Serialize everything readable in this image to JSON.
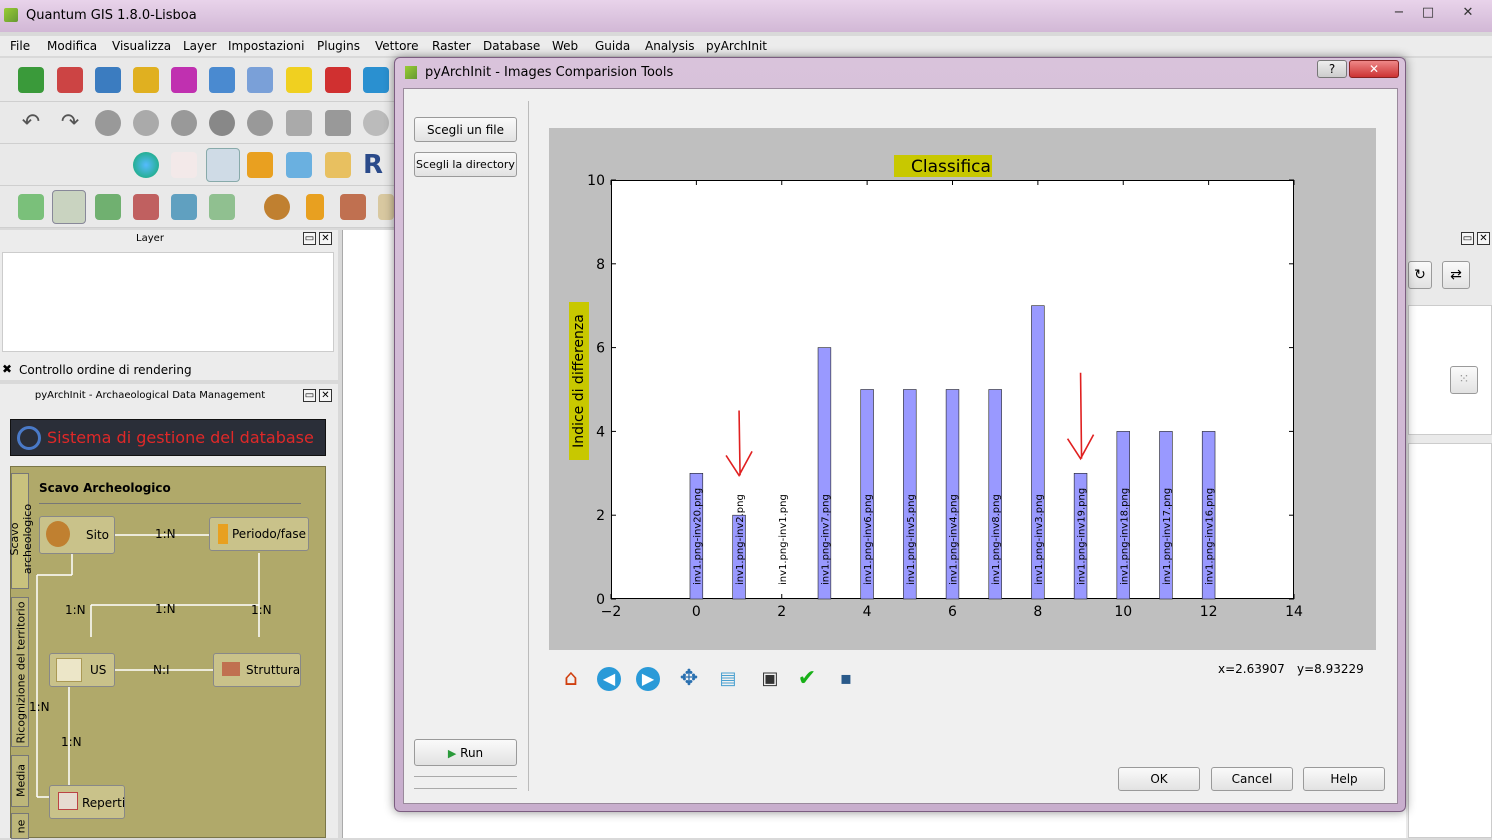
{
  "app": {
    "title": "Quantum GIS 1.8.0-Lisboa",
    "window_buttons": [
      "−",
      "□",
      "✕"
    ]
  },
  "menu": [
    "File",
    "Modifica",
    "Visualizza",
    "Layer",
    "Impostazioni",
    "Plugins",
    "Vettore",
    "Raster",
    "Database",
    "Web",
    "Guida",
    "Analysis",
    "pyArchInit"
  ],
  "layer_panel": {
    "title": "Layer",
    "render_order_label": "Controllo ordine di rendering"
  },
  "pyarchinit_panel": {
    "title": "pyArchInit - Archaeological Data Management",
    "banner": "Sistema di gestione del database",
    "tabs": [
      "Scavo archeologico",
      "Ricognizione del territorio",
      "Media",
      "ne"
    ],
    "section_title": "Scavo Archeologico",
    "nodes": {
      "sito": "Sito",
      "periodo": "Periodo/fase",
      "us": "US",
      "struttura": "Struttura",
      "reperti": "Reperti"
    },
    "relations": {
      "sito_periodo": "1:N",
      "sito_down": "1:N",
      "mid_center": "1:N",
      "mid_right": "1:N",
      "us_struttura": "N:I",
      "side": "1:N",
      "us_reperti": "1:N"
    }
  },
  "dialog": {
    "title": "pyArchInit - Images Comparision Tools",
    "help_btn": "?",
    "close_btn": "✕",
    "choose_file": "Scegli un file",
    "choose_dir": "Scegli la directory",
    "run": "Run",
    "ok": "OK",
    "cancel": "Cancel",
    "help": "Help",
    "coords_x": "x=2.63907",
    "coords_y": "y=8.93229"
  },
  "chart_data": {
    "type": "bar",
    "title": "Classifica",
    "ylabel": "Indice di differenza",
    "xlabel": "",
    "xlim": [
      -2,
      14
    ],
    "ylim": [
      0,
      10
    ],
    "xticks": [
      "−2",
      "0",
      "2",
      "4",
      "6",
      "8",
      "10",
      "12",
      "14"
    ],
    "yticks": [
      "0",
      "2",
      "4",
      "6",
      "8",
      "10"
    ],
    "color": "#9999ff",
    "bars": [
      {
        "x": 0,
        "value": 3,
        "label": "inv1.png-inv20.png"
      },
      {
        "x": 1,
        "value": 2,
        "label": "inv1.png-inv2.png"
      },
      {
        "x": 2,
        "value": 0,
        "label": "inv1.png-inv1.png"
      },
      {
        "x": 3,
        "value": 6,
        "label": "inv1.png-inv7.png"
      },
      {
        "x": 4,
        "value": 5,
        "label": "inv1.png-inv6.png"
      },
      {
        "x": 5,
        "value": 5,
        "label": "inv1.png-inv5.png"
      },
      {
        "x": 6,
        "value": 5,
        "label": "inv1.png-inv4.png"
      },
      {
        "x": 7,
        "value": 5,
        "label": "inv1.png-inv8.png"
      },
      {
        "x": 8,
        "value": 7,
        "label": "inv1.png-inv3.png"
      },
      {
        "x": 9,
        "value": 3,
        "label": "inv1.png-inv19.png"
      },
      {
        "x": 10,
        "value": 4,
        "label": "inv1.png-inv18.png"
      },
      {
        "x": 11,
        "value": 4,
        "label": "inv1.png-inv17.png"
      },
      {
        "x": 12,
        "value": 4,
        "label": "inv1.png-inv16.png"
      }
    ],
    "arrows_at_x": [
      1,
      9
    ],
    "arrow_color": "#e02020"
  },
  "icons": [
    "home-icon",
    "back-icon",
    "forward-icon",
    "pan-icon",
    "zoom-icon",
    "subplots-icon",
    "check-icon",
    "save-icon"
  ]
}
